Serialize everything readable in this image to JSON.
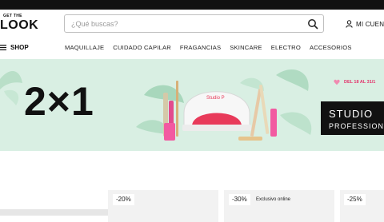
{
  "header": {
    "logo_top": "GET THE",
    "logo_main": "LOOK",
    "search_placeholder": "¿Qué buscas?",
    "account_label": "MI CUENTA"
  },
  "nav": {
    "shop_label": "SHOP",
    "items": [
      "MAQUILLAJE",
      "CUIDADO CAPILAR",
      "FRAGANCIAS",
      "SKINCARE",
      "ELECTRO",
      "ACCESORIOS"
    ]
  },
  "banner": {
    "promo": "2×1",
    "date": "DEL 18 AL 31/1",
    "brand_title": "STUDIO",
    "brand_sub": "PROFESSIONAL",
    "lamp_brand": "Studio P",
    "background_color": "#d9efe3",
    "accent_color": "#e2336b"
  },
  "products": [
    {
      "discount": "-20%",
      "note": ""
    },
    {
      "discount": "-30%",
      "note": "Exclusivo online"
    },
    {
      "discount": "-25%",
      "note": ""
    }
  ]
}
